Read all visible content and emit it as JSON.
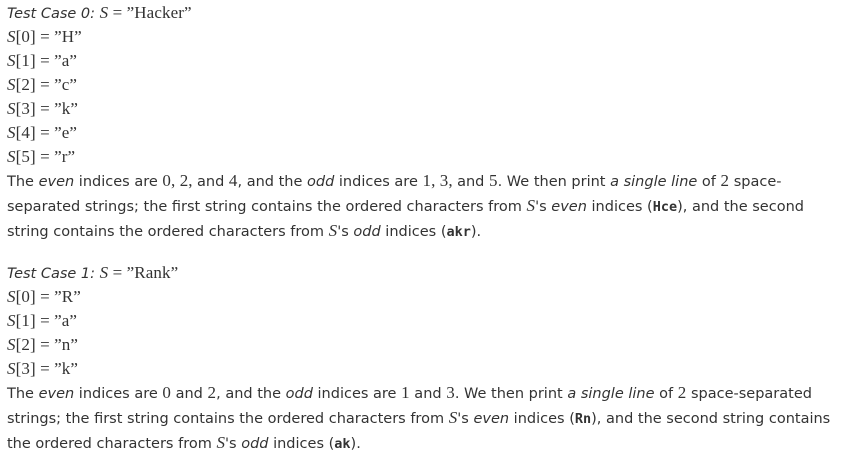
{
  "case0": {
    "heading": {
      "label": "Test Case 0: ",
      "var": "S",
      "eq": " = ",
      "value": "”Hacker”"
    },
    "rows": [
      {
        "var": "S",
        "index": "[0]",
        "eq": " = ",
        "value": "”H”"
      },
      {
        "var": "S",
        "index": "[1]",
        "eq": " = ",
        "value": "”a”"
      },
      {
        "var": "S",
        "index": "[2]",
        "eq": " = ",
        "value": "”c”"
      },
      {
        "var": "S",
        "index": "[3]",
        "eq": " = ",
        "value": "”k”"
      },
      {
        "var": "S",
        "index": "[4]",
        "eq": " = ",
        "value": "”e”"
      },
      {
        "var": "S",
        "index": "[5]",
        "eq": " = ",
        "value": "”r”"
      }
    ],
    "para": {
      "t1": "The ",
      "even": "even",
      "t2": " indices are ",
      "even_list": "0, 2, ",
      "and1": "and ",
      "even_last": "4",
      "t3": ", and the ",
      "odd": "odd",
      "t4": " indices are ",
      "odd_list": "1, 3, ",
      "and2": "and ",
      "odd_last": "5",
      "t5": ". We then print ",
      "single_line": "a single line",
      "t6": " of ",
      "count": "2",
      "t7": " space-separated strings; the first string contains the ordered characters from ",
      "svar1": "S",
      "t8": "'s ",
      "even2": "even",
      "t9": " indices (",
      "even_result": "Hce",
      "t10": "), and the second string contains the ordered characters from ",
      "svar2": "S",
      "t11": "'s ",
      "odd2": "odd",
      "t12": " indices (",
      "odd_result": "akr",
      "t13": ")."
    }
  },
  "case1": {
    "heading": {
      "label": "Test Case 1: ",
      "var": "S",
      "eq": " = ",
      "value": "”Rank”"
    },
    "rows": [
      {
        "var": "S",
        "index": "[0]",
        "eq": " = ",
        "value": "”R”"
      },
      {
        "var": "S",
        "index": "[1]",
        "eq": " = ",
        "value": "”a”"
      },
      {
        "var": "S",
        "index": "[2]",
        "eq": " = ",
        "value": "”n”"
      },
      {
        "var": "S",
        "index": "[3]",
        "eq": " = ",
        "value": "”k”"
      }
    ],
    "para": {
      "t1": "The ",
      "even": "even",
      "t2": " indices are ",
      "even_a": "0",
      "and1": " and ",
      "even_b": "2",
      "t3": ", and the ",
      "odd": "odd",
      "t4": " indices are ",
      "odd_a": "1",
      "and2": " and ",
      "odd_b": "3",
      "t5": ". We then print ",
      "single_line": "a single line",
      "t6": " of ",
      "count": "2",
      "t7": " space-separated strings; the first string contains the ordered characters from ",
      "svar1": "S",
      "t8": "'s ",
      "even2": "even",
      "t9": " indices (",
      "even_result": "Rn",
      "t10": "), and the second string contains the ordered characters from ",
      "svar2": "S",
      "t11": "'s ",
      "odd2": "odd",
      "t12": " indices (",
      "odd_result": "ak",
      "t13": ")."
    }
  }
}
